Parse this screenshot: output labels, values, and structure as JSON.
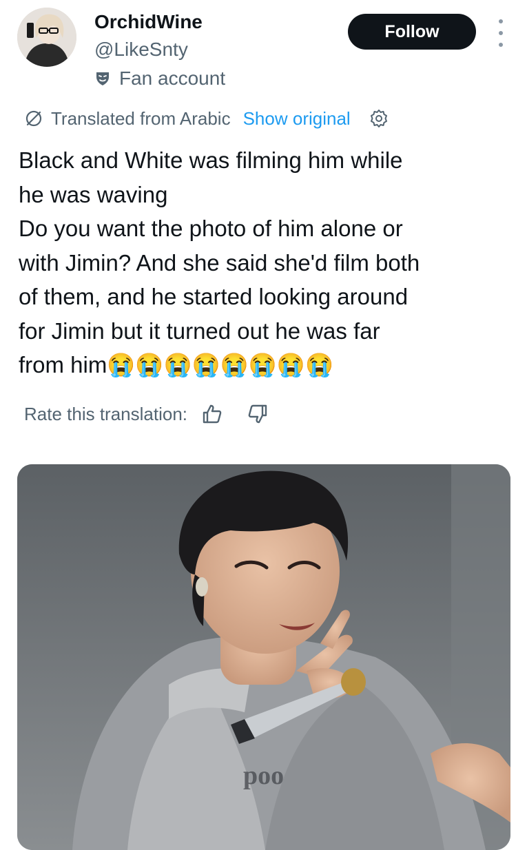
{
  "user": {
    "display_name": "OrchidWine",
    "handle": "@LikeSnty",
    "label": "Fan account"
  },
  "actions": {
    "follow_label": "Follow"
  },
  "translation": {
    "translated_label": "Translated from Arabic",
    "show_original_label": "Show original",
    "rate_label": "Rate this translation:"
  },
  "tweet": {
    "text": "Black and White was filming him while\nhe was waving\nDo you want the photo of him alone or\nwith Jimin? And she said she'd film both\nof them, and he started looking around\nfor Jimin but it turned out he was far\nfrom him😭😭😭😭😭😭😭😭"
  },
  "media": {
    "overlay_text": "poo"
  },
  "icons": {
    "more": "more-vertical-icon",
    "fan": "fan-account-badge-icon",
    "translate": "translate-icon",
    "settings": "gear-icon",
    "like_translation": "thumbs-up-icon",
    "dislike_translation": "thumbs-down-icon"
  },
  "colors": {
    "text_primary": "#0f1419",
    "text_secondary": "#536471",
    "link": "#1d9bf0",
    "follow_button_bg": "#0f1419",
    "follow_button_text": "#ffffff"
  }
}
